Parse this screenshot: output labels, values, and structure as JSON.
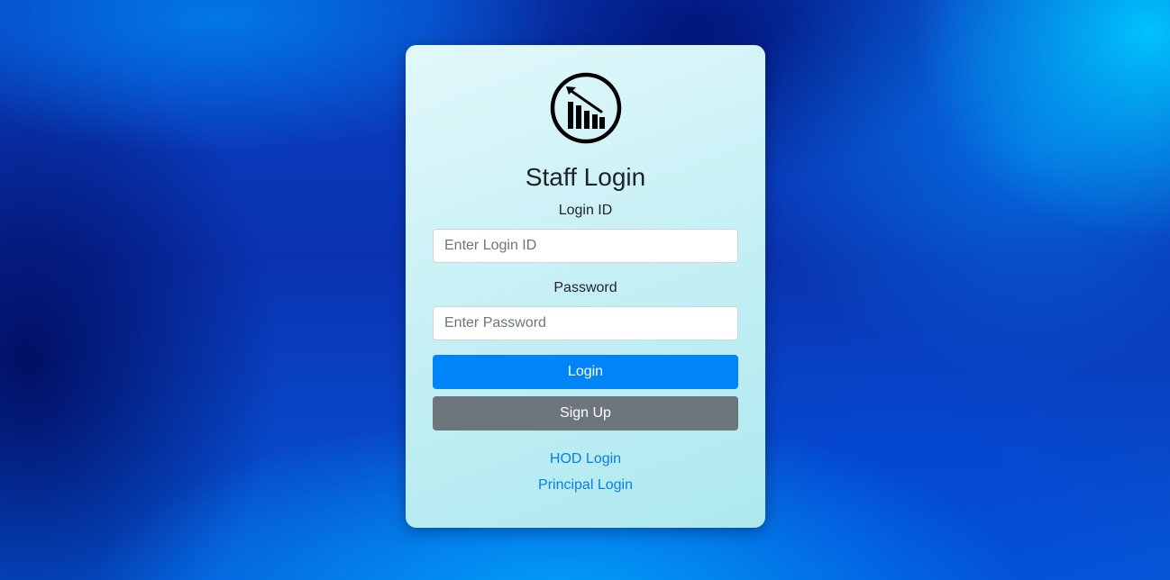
{
  "page": {
    "title": "Staff Login"
  },
  "logo": {
    "icon": "bar-chart-trend-icon"
  },
  "form": {
    "login_id": {
      "label": "Login ID",
      "placeholder": "Enter Login ID",
      "value": ""
    },
    "password": {
      "label": "Password",
      "placeholder": "Enter Password",
      "value": ""
    },
    "login_button": "Login",
    "signup_button": "Sign Up"
  },
  "links": {
    "hod": "HOD Login",
    "principal": "Principal Login"
  },
  "colors": {
    "primary": "#0085f9",
    "secondary": "#6d767d",
    "link": "#0a7ee8",
    "card": "#c5f0f5"
  }
}
